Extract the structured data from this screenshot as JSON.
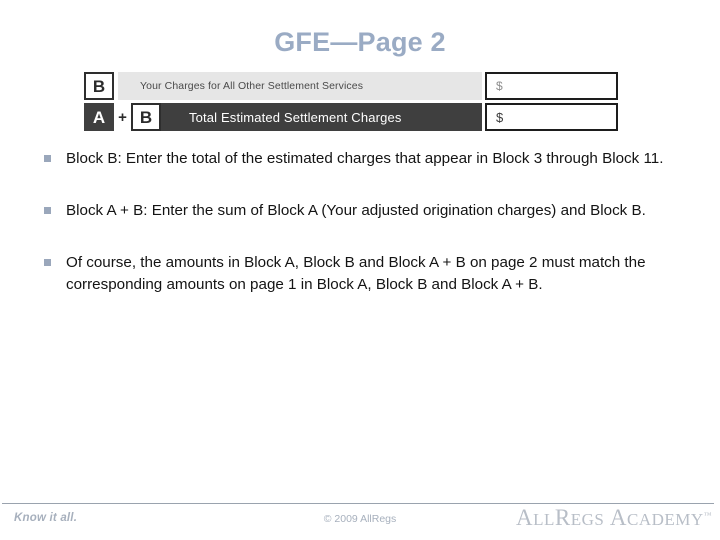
{
  "slide": {
    "title": "GFE—Page 2"
  },
  "form_graphic": {
    "rows": [
      {
        "badges": [
          "B"
        ],
        "label": "Your Charges for All Other Settlement Services",
        "amount": "$"
      },
      {
        "badges": [
          "A",
          "+",
          "B"
        ],
        "label": "Total Estimated Settlement Charges",
        "amount": "$"
      }
    ]
  },
  "bullets": [
    {
      "marker": "square-bullet",
      "text": "Block B: Enter the total of the estimated charges that appear in Block 3 through Block 11."
    },
    {
      "marker": "square-bullet",
      "text": "Block A + B: Enter the sum of Block A (Your adjusted origination charges) and Block B."
    },
    {
      "marker": "square-bullet",
      "text": "Of course, the amounts in Block A, Block B and Block A + B on page 2 must match the corresponding amounts on page 1 in Block A, Block B and Block A + B."
    }
  ],
  "footer": {
    "tagline": "Know it all.",
    "copyright": "© 2009 AllRegs",
    "logo": {
      "word1_cap": "A",
      "word1_rest": "LL",
      "word1_cap2": "R",
      "word1_rest2": "EGS",
      "word2_cap": "A",
      "word2_rest": "CADEMY",
      "trademark": "™"
    }
  },
  "colors": {
    "title": "#9aabc4",
    "dark_band": "#3f3f3f",
    "light_band": "#e6e6e6",
    "bullet": "#9aa7bb",
    "footer_text": "#a7b0bd"
  }
}
